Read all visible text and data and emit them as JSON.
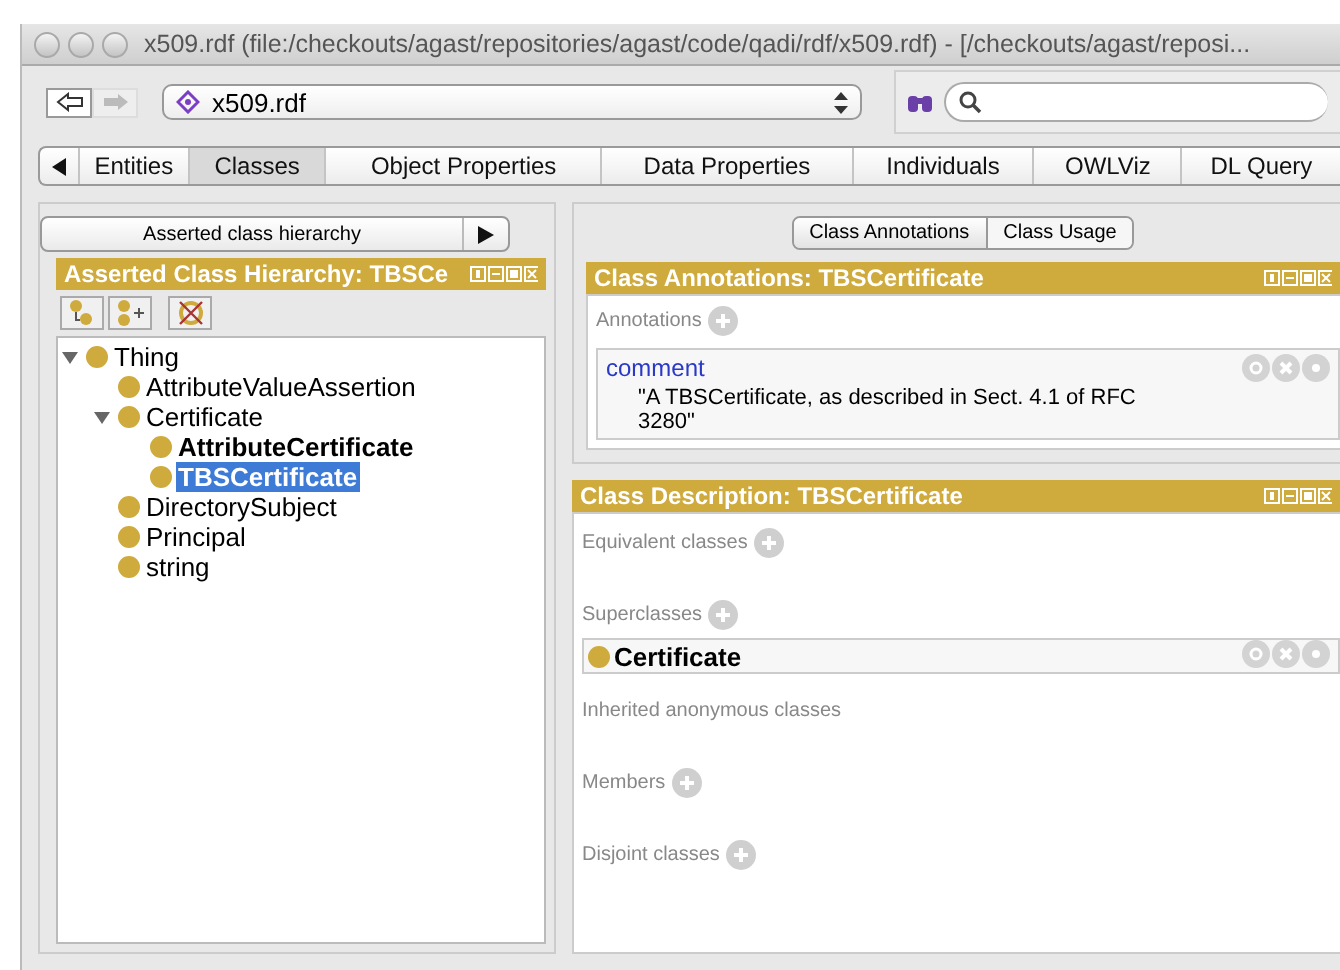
{
  "window": {
    "title": "x509.rdf (file:/checkouts/agast/repositories/agast/code/qadi/rdf/x509.rdf) - [/checkouts/agast/reposi..."
  },
  "toolbar": {
    "ontology": "x509.rdf"
  },
  "tabs": [
    {
      "label": "Entities",
      "selected": false
    },
    {
      "label": "Classes",
      "selected": true
    },
    {
      "label": "Object Properties",
      "selected": false
    },
    {
      "label": "Data Properties",
      "selected": false
    },
    {
      "label": "Individuals",
      "selected": false
    },
    {
      "label": "OWLViz",
      "selected": false
    },
    {
      "label": "DL Query",
      "selected": false
    }
  ],
  "left": {
    "view_selector": "Asserted class hierarchy",
    "header": "Asserted Class Hierarchy: TBSCe",
    "tree": [
      {
        "label": "Thing",
        "expanded": true,
        "selected": false,
        "bold": false,
        "children": [
          {
            "label": "AttributeValueAssertion",
            "selected": false,
            "bold": false
          },
          {
            "label": "Certificate",
            "expanded": true,
            "selected": false,
            "bold": false,
            "children": [
              {
                "label": "AttributeCertificate",
                "selected": false,
                "bold": true
              },
              {
                "label": "TBSCertificate",
                "selected": true,
                "bold": true
              }
            ]
          },
          {
            "label": "DirectorySubject",
            "selected": false,
            "bold": false
          },
          {
            "label": "Principal",
            "selected": false,
            "bold": false
          },
          {
            "label": "string",
            "selected": false,
            "bold": false
          }
        ]
      }
    ]
  },
  "subtabs": [
    {
      "label": "Class Annotations",
      "selected": true
    },
    {
      "label": "Class Usage",
      "selected": false
    }
  ],
  "annotations": {
    "header": "Class Annotations: TBSCertificate",
    "section": "Annotations",
    "items": [
      {
        "property": "comment",
        "value": "\"A TBSCertificate, as described in Sect. 4.1 of RFC 3280\""
      }
    ]
  },
  "description": {
    "header": "Class Description: TBSCertificate",
    "sections": [
      {
        "label": "Equivalent classes",
        "addable": true
      },
      {
        "label": "Superclasses",
        "addable": true,
        "items": [
          "Certificate"
        ]
      },
      {
        "label": "Inherited anonymous classes",
        "addable": false
      },
      {
        "label": "Members",
        "addable": true
      },
      {
        "label": "Disjoint classes",
        "addable": true
      }
    ]
  }
}
